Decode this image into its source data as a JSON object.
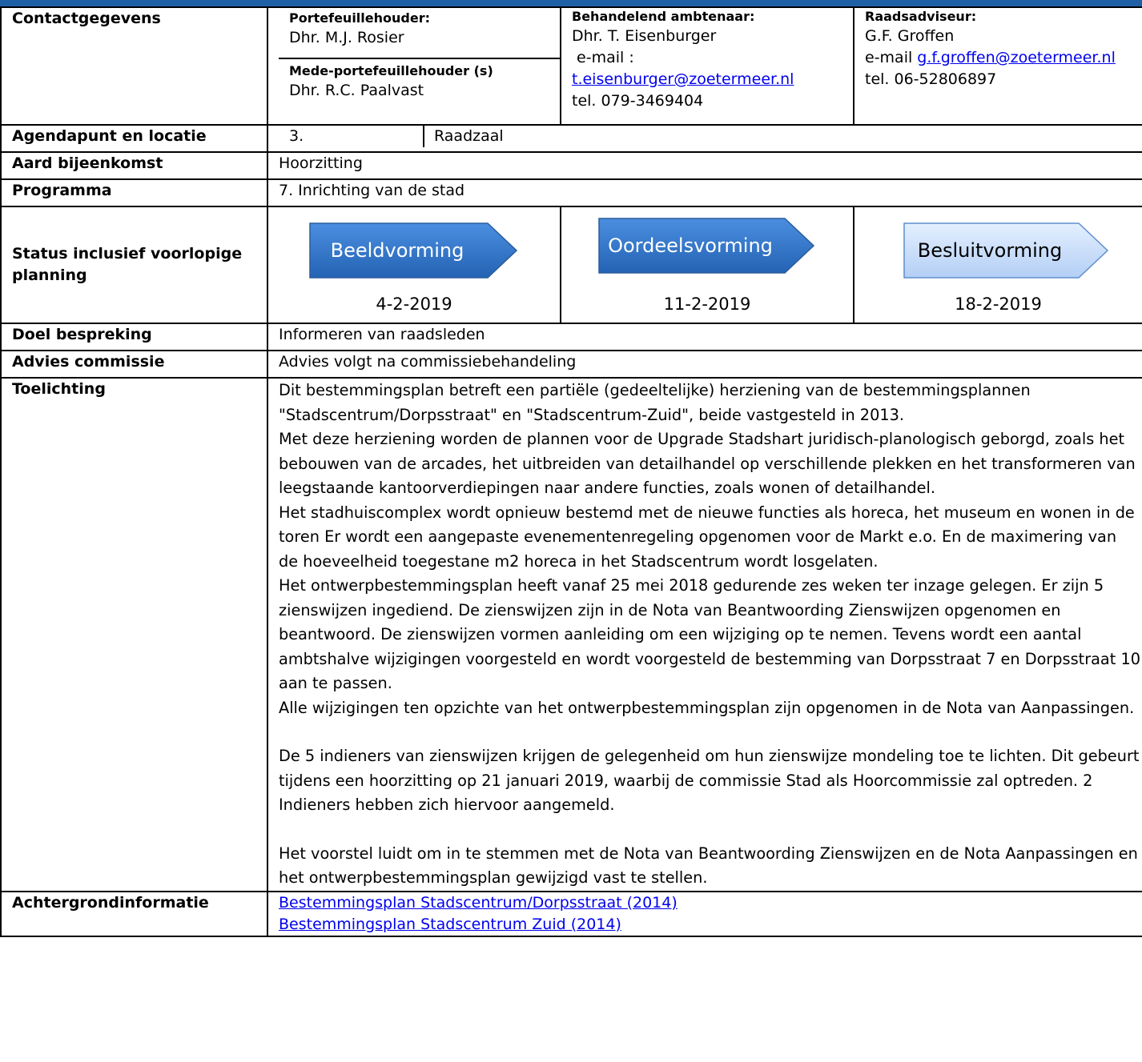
{
  "header_banner": "",
  "contact": {
    "label": "Contactgegevens",
    "portefeuille_title": "Portefeuillehouder:",
    "portefeuille_name": "Dhr. M.J. Rosier",
    "mede_title": "Mede-portefeuillehouder (s)",
    "mede_name": "Dhr. R.C. Paalvast",
    "ambtenaar_title": "Behandelend ambtenaar:",
    "ambtenaar_name": "Dhr. T. Eisenburger",
    "ambtenaar_email_label": " e-mail :",
    "ambtenaar_email": "t.eisenburger@zoetermeer.nl",
    "ambtenaar_tel": "tel. 079-3469404",
    "adviseur_title": "Raadsadviseur:",
    "adviseur_name": "G.F. Groffen",
    "adviseur_email_label": "e-mail ",
    "adviseur_email": "g.f.groffen@zoetermeer.nl",
    "adviseur_tel": "tel. 06-52806897"
  },
  "agendapunt": {
    "label": "Agendapunt en locatie",
    "number": "3.",
    "location": "Raadzaal"
  },
  "aard": {
    "label": "Aard bijeenkomst",
    "value": "Hoorzitting"
  },
  "programma": {
    "label": "Programma",
    "value": "7. Inrichting van de stad"
  },
  "status": {
    "label": "Status inclusief voorlopige planning",
    "steps": [
      {
        "label": "Beeldvorming",
        "date": "4-2-2019",
        "color": "#2f73c9"
      },
      {
        "label": "Oordeelsvorming",
        "date": "11-2-2019",
        "color": "#2f73c9"
      },
      {
        "label": "Besluitvorming",
        "date": "18-2-2019",
        "color": "#c9defa"
      }
    ]
  },
  "doel": {
    "label": "Doel bespreking",
    "value": "Informeren van raadsleden"
  },
  "advies": {
    "label": "Advies commissie",
    "value": "Advies volgt na commissiebehandeling"
  },
  "toelichting": {
    "label": "Toelichting",
    "p1": "Dit bestemmingsplan betreft een partiële (gedeeltelijke) herziening van de bestemmingsplannen \"Stadscentrum/Dorpsstraat\" en \"Stadscentrum-Zuid\", beide vastgesteld in 2013.",
    "p2": "Met deze herziening worden de plannen voor de Upgrade Stadshart juridisch-planologisch geborgd, zoals het bebouwen van de arcades, het uitbreiden van detailhandel op verschillende plekken en het transformeren van leegstaande kantoorverdiepingen naar andere functies, zoals wonen of detailhandel.",
    "p3": "Het stadhuiscomplex wordt opnieuw bestemd met de nieuwe functies als horeca, het museum en wonen in de toren Er wordt een aangepaste evenementenregeling opgenomen voor de Markt e.o. En de maximering van de hoeveelheid toegestane m2 horeca in het Stadscentrum wordt losgelaten.",
    "p4": "Het ontwerpbestemmingsplan heeft vanaf 25 mei 2018 gedurende zes weken ter inzage gelegen. Er zijn 5 zienswijzen ingediend. De zienswijzen zijn in de Nota van Beantwoording Zienswijzen opgenomen en beantwoord. De zienswijzen vormen aanleiding om een wijziging op te nemen. Tevens wordt een aantal ambtshalve wijzigingen voorgesteld en wordt voorgesteld de bestemming van Dorpsstraat 7 en Dorpsstraat 10 aan te passen.",
    "p5": "Alle wijzigingen ten opzichte van het ontwerpbestemmingsplan zijn opgenomen in de Nota van Aanpassingen.",
    "p6": "De 5 indieners van zienswijzen krijgen de gelegenheid om hun zienswijze mondeling toe te lichten. Dit gebeurt tijdens een hoorzitting op 21 januari 2019, waarbij de commissie Stad als Hoorcommissie zal optreden. 2 Indieners hebben zich hiervoor aangemeld.",
    "p7": "Het voorstel luidt om in te stemmen met de Nota van Beantwoording Zienswijzen en de Nota Aanpassingen en het ontwerpbestemmingsplan gewijzigd vast te stellen."
  },
  "achtergrond": {
    "label": "Achtergrondinformatie",
    "links": [
      "Bestemmingsplan Stadscentrum/Dorpsstraat (2014)",
      "Bestemmingsplan Stadscentrum Zuid (2014)"
    ]
  }
}
